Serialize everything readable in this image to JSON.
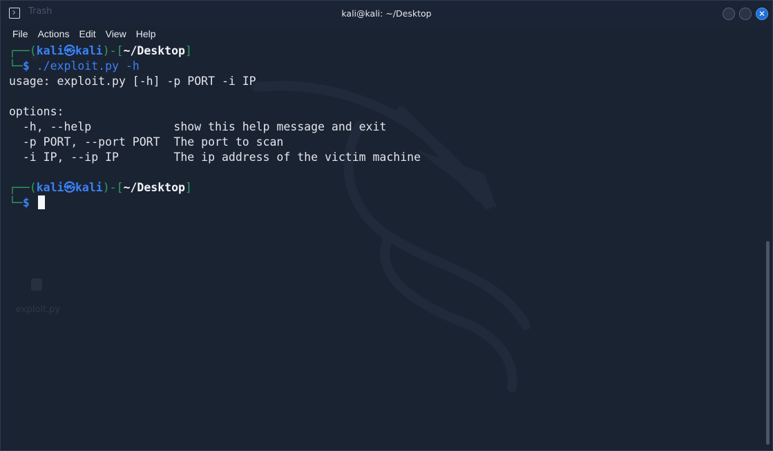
{
  "window": {
    "title": "kali@kali: ~/Desktop",
    "ghost_title": "Trash",
    "close_glyph": "✕"
  },
  "menu": {
    "items": [
      "File",
      "Actions",
      "Edit",
      "View",
      "Help"
    ]
  },
  "desktop": {
    "file_label": "exploit.py"
  },
  "terminal": {
    "prompt1": {
      "prefix": "┌──(",
      "user": "kali",
      "at": "㉿",
      "host": "kali",
      "mid": ")-[",
      "path": "~/Desktop",
      "suffix": "]",
      "line2_prefix": "└─",
      "dollar": "$",
      "command": "./exploit.py -h"
    },
    "output": [
      "usage: exploit.py [-h] -p PORT -i IP",
      "",
      "options:",
      "  -h, --help            show this help message and exit",
      "  -p PORT, --port PORT  The port to scan",
      "  -i IP, --ip IP        The ip address of the victim machine",
      ""
    ],
    "prompt2": {
      "prefix": "┌──(",
      "user": "kali",
      "at": "㉿",
      "host": "kali",
      "mid": ")-[",
      "path": "~/Desktop",
      "suffix": "]",
      "line2_prefix": "└─",
      "dollar": "$"
    }
  },
  "icons": {
    "app": "terminal-icon",
    "minimize": "minimize-icon",
    "maximize": "maximize-icon",
    "close": "close-icon"
  }
}
